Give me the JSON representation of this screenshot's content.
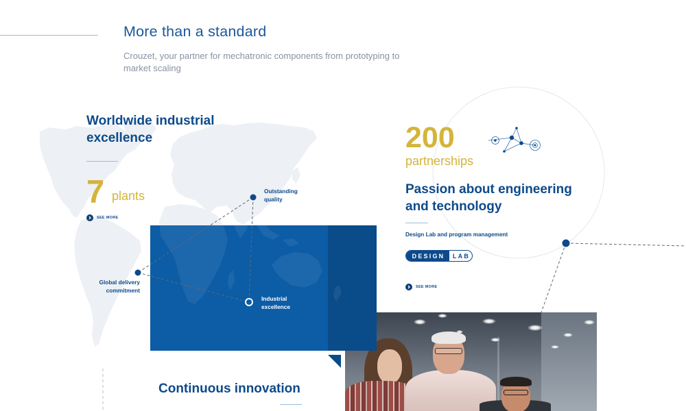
{
  "header": {
    "title": "More than a standard",
    "subtitle_lines": [
      "Crouzet, your partner for mechatronic components from prototyping to",
      "market scaling"
    ]
  },
  "worldwide": {
    "title_lines": [
      "Worldwide industrial",
      "excellence"
    ],
    "stat_value": "7",
    "stat_label": "plants",
    "link_label": "SEE MORE"
  },
  "map_points": {
    "quality": [
      "Outstanding",
      "quality"
    ],
    "delivery": [
      "Global delivery",
      "commitment"
    ],
    "excellence": [
      "Industrial",
      "excellence"
    ]
  },
  "engineering": {
    "stat_value": "200",
    "stat_label": "partnerships",
    "title_lines": [
      "Passion about engineering",
      "and technology"
    ],
    "subtitle": "Design Lab and program management",
    "badge": {
      "left": "DESIGN",
      "right": "LAB"
    },
    "link_label": "SEE MORE"
  },
  "innovation": {
    "title": "Continuous innovation"
  },
  "icons": {
    "see_more": "arrow-right-circle-icon",
    "network": "network-graph-icon"
  },
  "colors": {
    "primary": "#0d4a8b",
    "title": "#1c5799",
    "accent_yellow": "#d4b43a",
    "muted_text": "#8893a3",
    "panel_blue": "#0c5ca6",
    "panel_blue_dark": "#0a4b89",
    "rule_blue": "#9bbbe0",
    "map_gray": "#edf0f4"
  }
}
